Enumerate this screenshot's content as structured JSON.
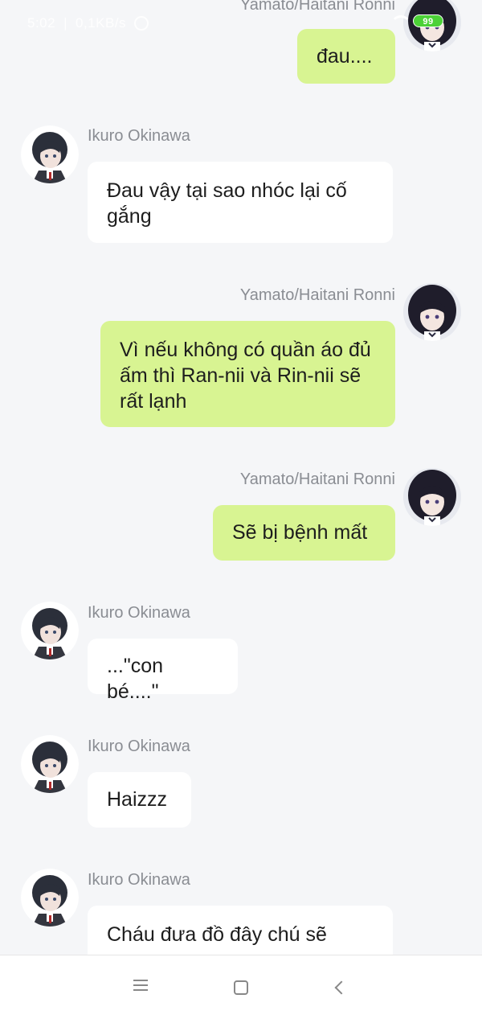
{
  "status_bar": {
    "time": "5:02",
    "speed": "0,1KB/s",
    "battery": "99"
  },
  "messages": [
    {
      "sender": "Yamato/Haitani Ronni",
      "side": "right",
      "text": "đau...."
    },
    {
      "sender": "Ikuro Okinawa",
      "side": "left",
      "text": "Đau vậy tại sao nhóc lại cố gắng"
    },
    {
      "sender": "Yamato/Haitani Ronni",
      "side": "right",
      "text": "Vì nếu không có quần áo đủ ấm thì Ran-nii và Rin-nii sẽ rất lạnh"
    },
    {
      "sender": "Yamato/Haitani Ronni",
      "side": "right",
      "text": "Sẽ bị bệnh mất"
    },
    {
      "sender": "Ikuro Okinawa",
      "side": "left",
      "text": "...\"con bé....\""
    },
    {
      "sender": "Ikuro Okinawa",
      "side": "left",
      "text": "Haizzz"
    },
    {
      "sender": "Ikuro Okinawa",
      "side": "left",
      "text": "Cháu đưa đồ đây chú sẽ"
    }
  ],
  "colors": {
    "background": "#f5f6f8",
    "bubble_self": "#d8f492",
    "bubble_other": "#ffffff",
    "name": "#8a8d93"
  },
  "icons": {
    "nav_menu": "menu-icon",
    "nav_home": "square-home-icon",
    "nav_back": "chevron-left-icon"
  }
}
